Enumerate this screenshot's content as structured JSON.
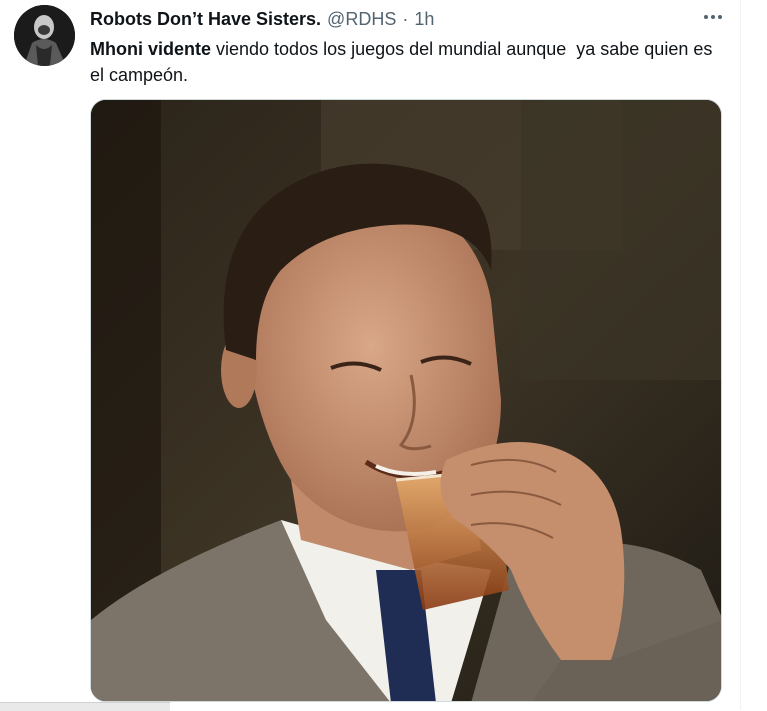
{
  "tweet": {
    "display_name": "Robots Don’t Have Sisters.",
    "handle": "@RDHS",
    "separator": "·",
    "time": "1h",
    "text_bold": "Mhoni vidente",
    "text_rest": " viendo todos los juegos del mundial aunque  ya sabe quien es el campeón.",
    "more_icon": "more-horizontal-icon",
    "avatar_icon": "profile-avatar"
  },
  "colors": {
    "text_primary": "#0f1419",
    "text_secondary": "#536471",
    "border": "#cfd9de"
  }
}
